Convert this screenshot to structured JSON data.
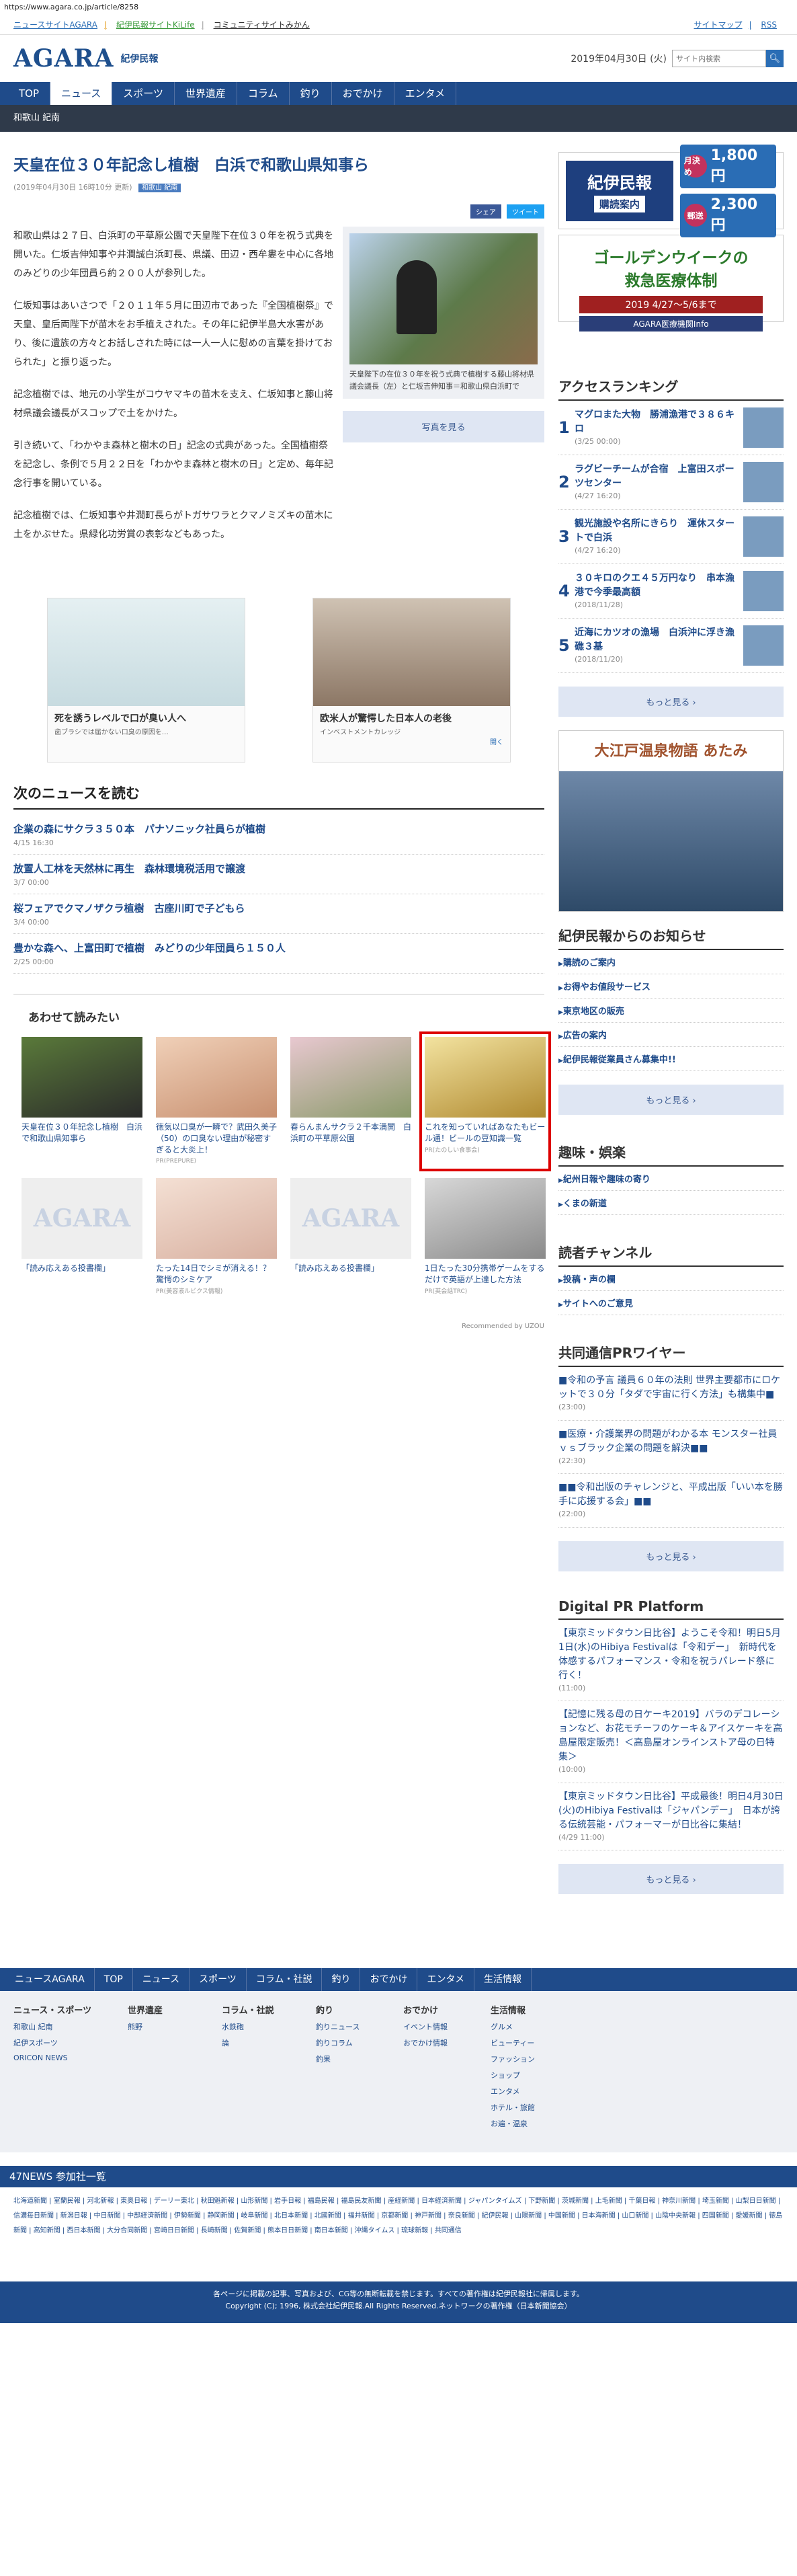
{
  "url": "https://www.agara.co.jp/article/8258",
  "topbar": {
    "links": [
      "ニュースサイトAGARA",
      "紀伊民報サイトKiLife",
      "コミュニティサイトみかん"
    ],
    "right": [
      "サイトマップ",
      "RSS"
    ]
  },
  "header": {
    "logo": "AGARA",
    "logo_sub": "紀伊民報",
    "date": "2019年04月30日 (火)",
    "search_placeholder": "サイト内検索"
  },
  "nav": [
    "TOP",
    "ニュース",
    "スポーツ",
    "世界遺産",
    "コラム",
    "釣り",
    "おでかけ",
    "エンタメ"
  ],
  "subnav": "和歌山 紀南",
  "article": {
    "title": "天皇在位３０年記念し植樹　白浜で和歌山県知事ら",
    "meta": "(2019年04月30日 16時10分 更新)",
    "tag": "和歌山 紀南",
    "share_fb": "シェア",
    "share_tw": "ツイート",
    "paragraphs": [
      "和歌山県は２７日、白浜町の平草原公園で天皇陛下在位３０年を祝う式典を開いた。仁坂吉伸知事や井澗誠白浜町長、県議、田辺・西牟婁を中心に各地のみどりの少年団員ら約２００人が参列した。",
      "仁坂知事はあいさつで「２０１１年５月に田辺市であった『全国植樹祭』で天皇、皇后両陛下が苗木をお手植えされた。その年に紀伊半島大水害があり、後に遺族の方々とお話しされた時には一人一人に慰めの言葉を掛けておられた」と振り返った。",
      "記念植樹では、地元の小学生がコウヤマキの苗木を支え、仁坂知事と藤山将材県議会議長がスコップで土をかけた。",
      "引き続いて、「わかやま森林と樹木の日」記念の式典があった。全国植樹祭を記念し、条例で５月２２日を「わかやま森林と樹木の日」と定め、毎年記念行事を開いている。",
      "記念植樹では、仁坂知事や井澗町長らがトガサワラとクマノミズキの苗木に土をかぶせた。県緑化功労賞の表彰などもあった。"
    ],
    "caption": "天皇陛下の在位３０年を祝う式典で植樹する藤山将材県議会議長（左）と仁坂吉伸知事＝和歌山県白浜町で",
    "photo_button": "写真を見る"
  },
  "ads": [
    {
      "title": "死を誘うレベルで口が臭い人へ",
      "sub": "歯ブラシでは届かない口臭の原因を…"
    },
    {
      "title": "欧米人が驚愕した日本人の老後",
      "sub": "インベストメントカレッジ",
      "cta": "開く"
    }
  ],
  "next_news": {
    "title": "次のニュースを読む",
    "items": [
      {
        "title": "企業の森にサクラ３５０本　パナソニック社員らが植樹",
        "date": "4/15 16:30"
      },
      {
        "title": "放置人工林を天然林に再生　森林環境税活用で譲渡",
        "date": "3/7 00:00"
      },
      {
        "title": "桜フェアでクマノザクラ植樹　古座川町で子どもら",
        "date": "3/4 00:00"
      },
      {
        "title": "豊かな森へ、上富田町で植樹　みどりの少年団員ら１５０人",
        "date": "2/25 00:00"
      }
    ]
  },
  "related": {
    "title": "あわせて読みたい",
    "items": [
      {
        "title": "天皇在位３０年記念し植樹　白浜で和歌山県知事ら",
        "pr": ""
      },
      {
        "title": "徳気以口臭が一瞬で？武田久美子（50）の口臭ない理由が秘密すぎると大炎上！",
        "pr": "PR(PREPURE)"
      },
      {
        "title": "春らんまんサクラ２千本満開　白浜町の平草原公園",
        "pr": ""
      },
      {
        "title": "これを知っていればあなたもビール通！ビールの豆知識一覧",
        "pr": "PR(たのしい食事会)"
      },
      {
        "title": "「読み応えある投書欄」",
        "pr": ""
      },
      {
        "title": "たった14日でシミが消える！？驚愕のシミケア",
        "pr": "PR(美容液ルビクス情報)"
      },
      {
        "title": "「読み応えある投書欄」",
        "pr": ""
      },
      {
        "title": "1日たった30分携帯ゲームをするだけで英語が上達した方法",
        "pr": "PR(英会話TRC)"
      }
    ],
    "recommended": "Recommended by UZOU"
  },
  "right": {
    "subscribe": {
      "brand": "紀伊民報",
      "label": "購読案内",
      "monthly_label": "月決め",
      "monthly": "1,800円",
      "term_label": "郵送",
      "term": "2,300円"
    },
    "gw": {
      "line1": "ゴールデンウイークの",
      "line2": "救急医療体制",
      "line3": "2019 4/27～5/6まで",
      "line4": "AGARA医療機関Info"
    },
    "ranking_title": "アクセスランキング",
    "ranking": [
      {
        "n": "1",
        "title": "マグロまた大物　勝浦漁港で３８６キロ",
        "date": "(3/25 00:00)"
      },
      {
        "n": "2",
        "title": "ラグビーチームが合宿　上富田スポーツセンター",
        "date": "(4/27 16:20)"
      },
      {
        "n": "3",
        "title": "観光施設や名所にきらり　運休スタートで白浜",
        "date": "(4/27 16:20)"
      },
      {
        "n": "4",
        "title": "３０キロのクエ４５万円なり　串本漁港で今季最高額",
        "date": "(2018/11/28)"
      },
      {
        "n": "5",
        "title": "近海にカツオの漁場　白浜沖に浮き漁礁３基",
        "date": "(2018/11/20)"
      }
    ],
    "more": "もっと見る ›",
    "hotel_ad": "大江戸温泉物語 あたみ",
    "info_title": "紀伊民報からのお知らせ",
    "info": [
      "購読のご案内",
      "お得やお値段サービス",
      "東京地区の販売",
      "広告の案内",
      "紀伊民報従業員さん募集中!!"
    ],
    "hobby_title": "趣味・娯楽",
    "hobby": [
      "紀州日報や趣味の寄り",
      "くまの新道"
    ],
    "reader_title": "読者チャンネル",
    "reader": [
      "投稿・声の欄",
      "サイトへのご意見"
    ],
    "wire_title": "共同通信PRワイヤー",
    "wire": [
      {
        "t": "■令和の予言 議員６０年の法則 世界主要都市にロケットで３０分「タダで宇宙に行く方法」も構集中■",
        "d": "(23:00)"
      },
      {
        "t": "■医療・介護業界の問題がわかる本 モンスター社員ｖｓブラック企業の問題を解決■■",
        "d": "(22:30)"
      },
      {
        "t": "■■令和出版のチャレンジと、平成出版「いい本を勝手に応援する会」■■",
        "d": "(22:00)"
      }
    ],
    "dpr_title": "Digital PR Platform",
    "dpr": [
      {
        "t": "【東京ミッドタウン日比谷】ようこそ令和！明日5月1日(水)のHibiya Festivalは「令和デー」　新時代を体感するパフォーマンス・令和を祝うパレード祭に行く！",
        "d": "(11:00)"
      },
      {
        "t": "【記憶に残る母の日ケーキ2019】バラのデコレーションなど、お花モチーフのケーキ＆アイスケーキを高島屋限定販売！＜高島屋オンラインストア母の日特集＞",
        "d": "(10:00)"
      },
      {
        "t": "【東京ミッドタウン日比谷】平成最後！明日4月30日(火)のHibiya Festivalは「ジャパンデー」　日本が誇る伝統芸能・パフォーマーが日比谷に集結！",
        "d": "(4/29 11:00)"
      }
    ]
  },
  "footer": {
    "nav": [
      "ニュースAGARA",
      "TOP",
      "ニュース",
      "スポーツ",
      "コラム・社説",
      "釣り",
      "おでかけ",
      "エンタメ",
      "生活情報"
    ],
    "cols": [
      {
        "h": "ニュース・スポーツ",
        "i": [
          "和歌山 紀南",
          "紀伊スポーツ",
          "ORICON NEWS"
        ]
      },
      {
        "h": "世界遺産",
        "i": [
          "熊野"
        ]
      },
      {
        "h": "コラム・社説",
        "i": [
          "水鉄砲",
          "論"
        ]
      },
      {
        "h": "釣り",
        "i": [
          "釣りニュース",
          "釣りコラム",
          "釣果"
        ]
      },
      {
        "h": "おでかけ",
        "i": [
          "イベント情報",
          "おでかけ情報"
        ]
      },
      {
        "h": "生活情報",
        "i": [
          "グルメ",
          "ビューティー",
          "ファッション",
          "ショップ",
          "エンタメ",
          "ホテル・旅館",
          "お遍・温泉"
        ]
      }
    ],
    "news47": "47NEWS 参加社一覧",
    "papers": "北海道新聞 | 室蘭民報 | 河北新報 | 東奥日報 | デーリー東北 | 秋田魁新報 | 山形新聞 | 岩手日報 | 福島民報 | 福島民友新聞 | 産経新聞 | 日本経済新聞 | ジャパンタイムズ | 下野新聞 | 茨城新聞 | 上毛新聞 | 千葉日報 | 神奈川新聞 | 埼玉新聞 | 山梨日日新聞 | 信濃毎日新聞 | 新潟日報 | 中日新聞 | 中部経済新聞 | 伊勢新聞 | 静岡新聞 | 岐阜新聞 | 北日本新聞 | 北國新聞 | 福井新聞 | 京都新聞 | 神戸新聞 | 奈良新聞 | 紀伊民報 | 山陽新聞 | 中国新聞 | 日本海新聞 | 山口新聞 | 山陰中央新報 | 四国新聞 | 愛媛新聞 | 徳島新聞 | 高知新聞 | 西日本新聞 | 大分合同新聞 | 宮崎日日新聞 | 長崎新聞 | 佐賀新聞 | 熊本日日新聞 | 南日本新聞 | 沖縄タイムス | 琉球新報 | 共同通信",
    "copy1": "各ページに掲載の記事、写真および、CG等の無断転載を禁じます。すべての著作権は紀伊民報社に帰属します。",
    "copy2": "Copyright (C); 1996, 株式会社紀伊民報.All Rights Reserved.ネットワークの著作権（日本新聞協会）"
  }
}
